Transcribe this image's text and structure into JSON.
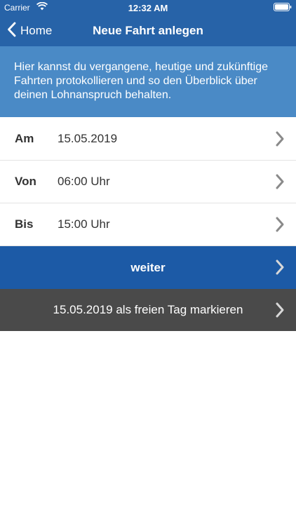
{
  "status": {
    "carrier": "Carrier",
    "time": "12:32 AM"
  },
  "nav": {
    "back_label": "Home",
    "title": "Neue Fahrt anlegen"
  },
  "banner": {
    "text": "Hier kannst du vergangene, heutige und zukünftige Fahrten protokollieren und so den Überblick über deinen Lohnanspruch behalten."
  },
  "rows": [
    {
      "label": "Am",
      "value": "15.05.2019"
    },
    {
      "label": "Von",
      "value": "06:00 Uhr"
    },
    {
      "label": "Bis",
      "value": "15:00 Uhr"
    }
  ],
  "actions": {
    "next_label": "weiter",
    "free_day_label": "15.05.2019 als freien Tag markieren"
  },
  "colors": {
    "navbar": "#2763a8",
    "banner": "#4a8ac6",
    "primary_action": "#1c5aa6",
    "secondary_action": "#4a4a4a"
  },
  "icons": [
    "wifi-icon",
    "battery-icon",
    "back-chevron-icon",
    "chevron-right-icon"
  ]
}
